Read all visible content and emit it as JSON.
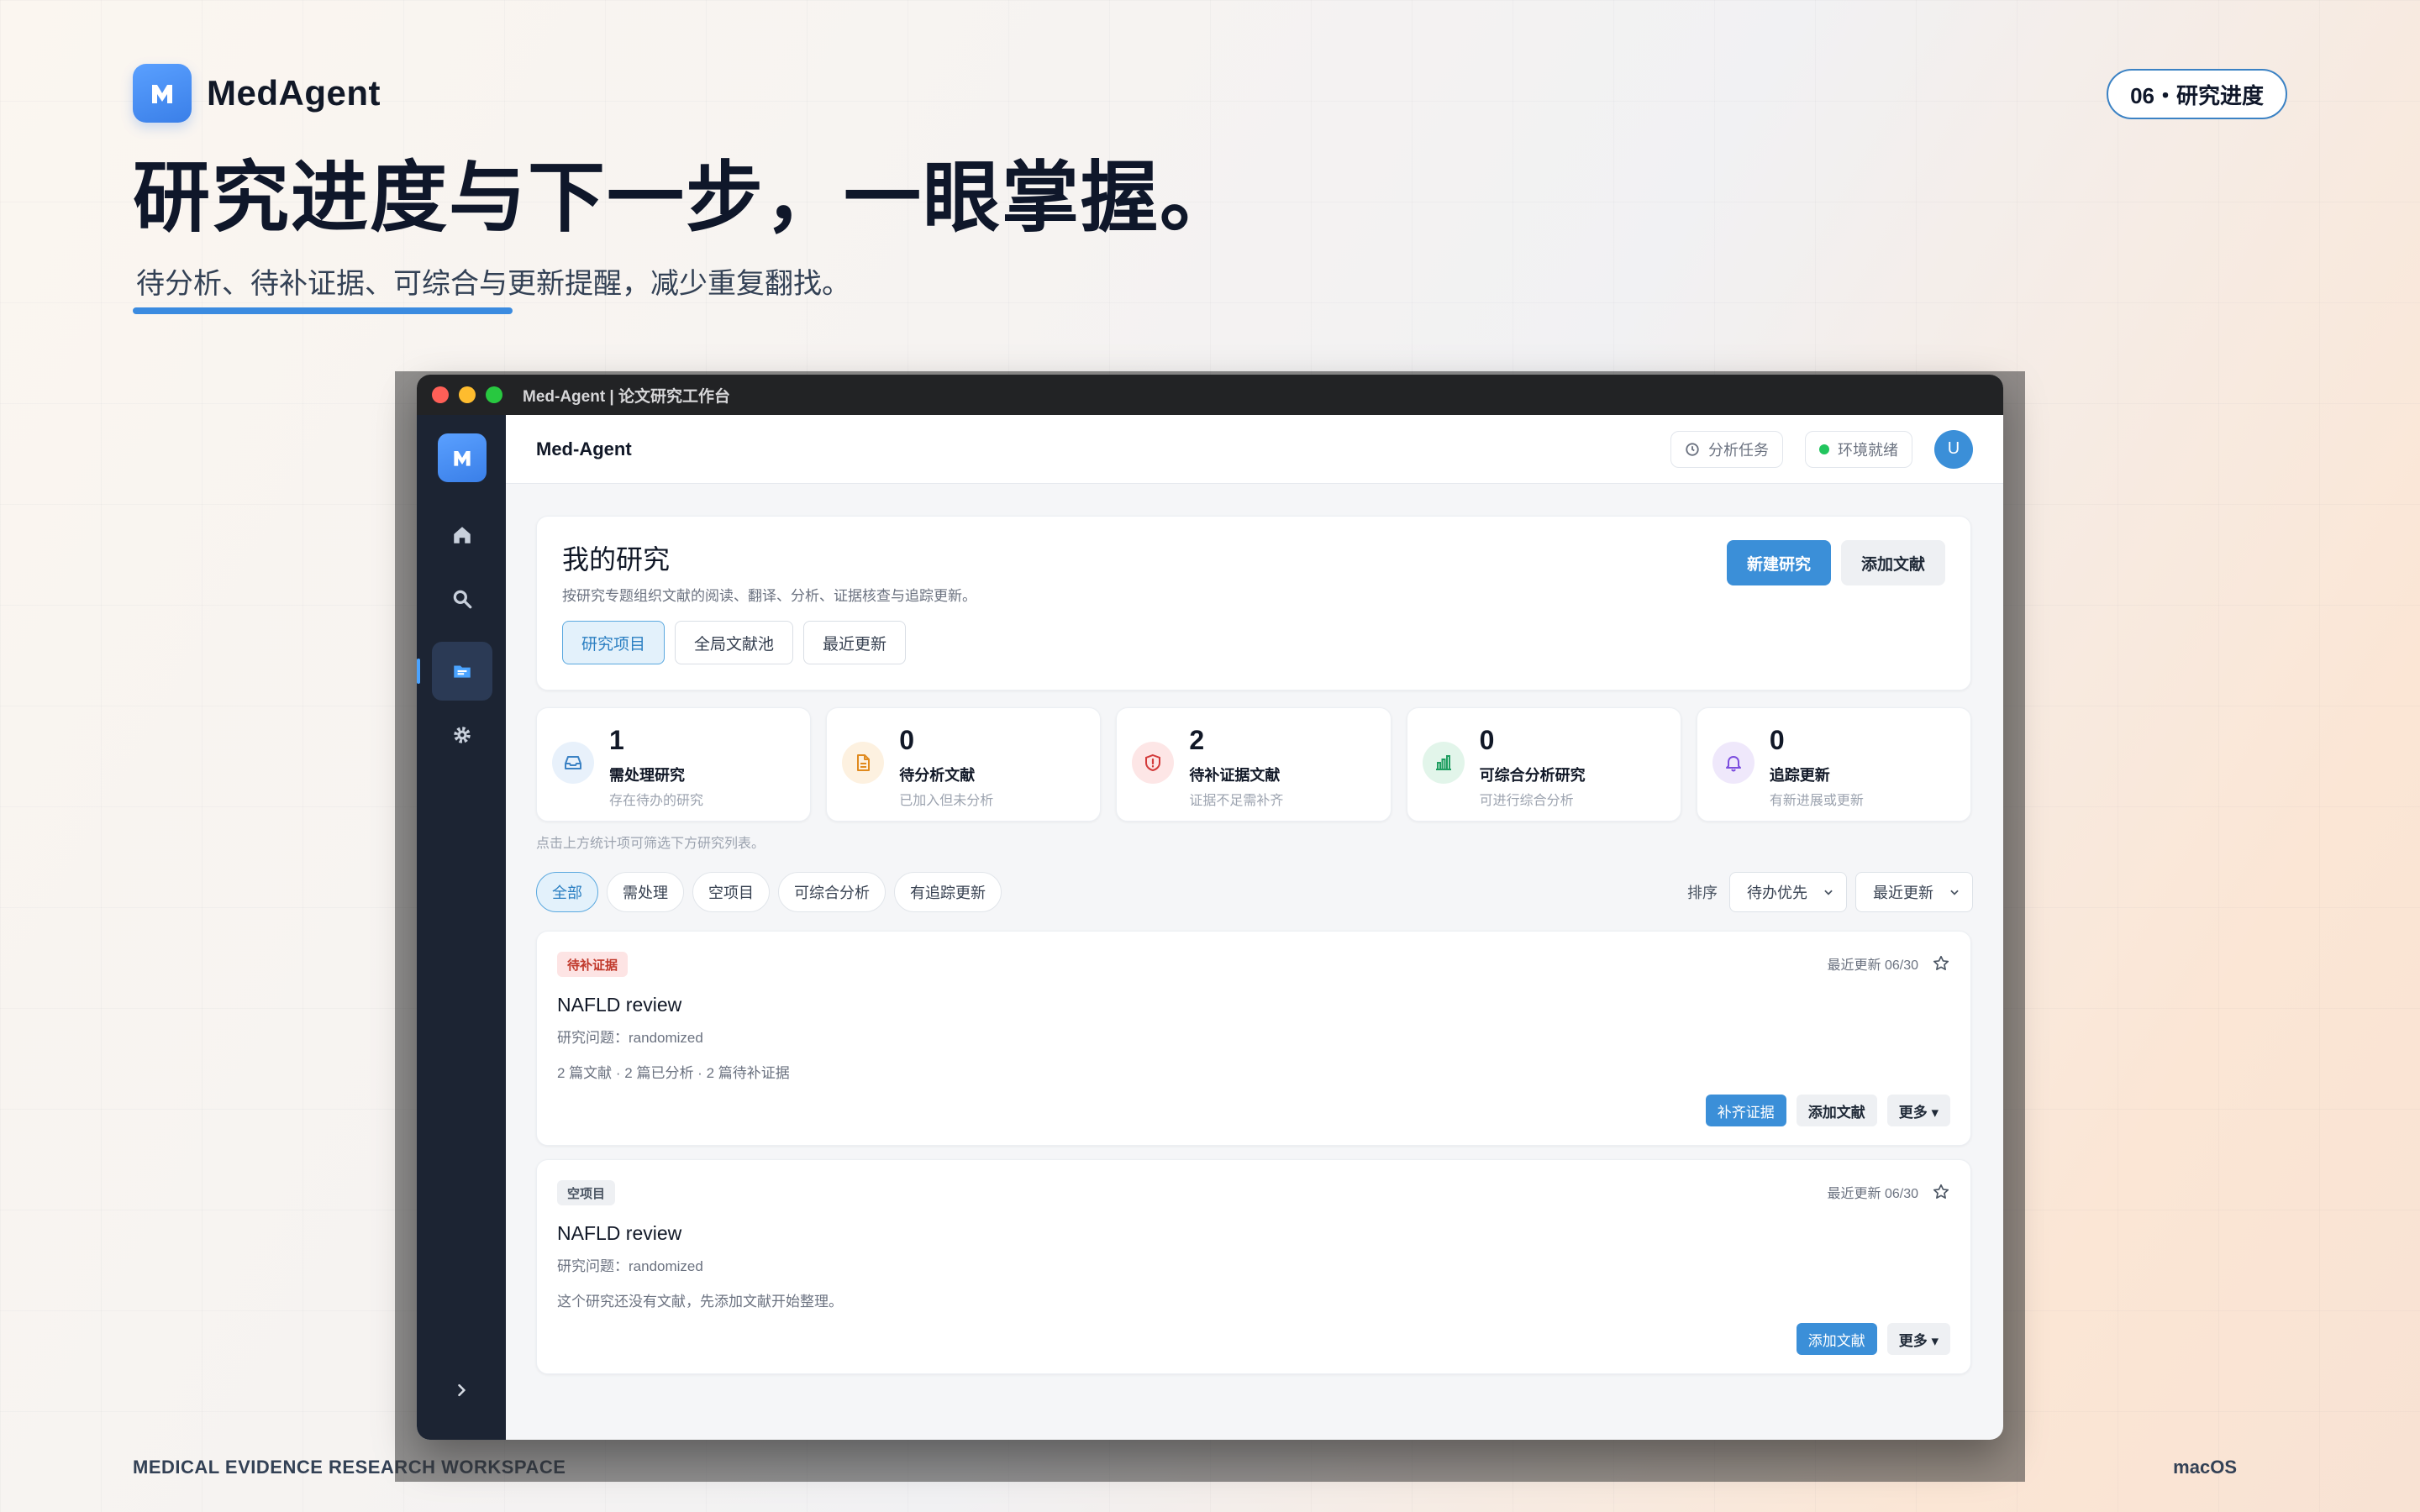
{
  "brand": {
    "name": "MedAgent"
  },
  "section_label": "06・研究进度",
  "headline": "研究进度与下一步，一眼掌握。",
  "subheadline": "待分析、待补证据、可综合与更新提醒，减少重复翻找。",
  "footer": {
    "left": "MEDICAL EVIDENCE RESEARCH WORKSPACE",
    "right": "macOS"
  },
  "window": {
    "title": "Med-Agent | 论文研究工作台"
  },
  "sidebar": {
    "items": [
      {
        "name": "home",
        "icon": "home-icon"
      },
      {
        "name": "search",
        "icon": "search-icon"
      },
      {
        "name": "research",
        "icon": "folder-icon",
        "active": true
      },
      {
        "name": "settings",
        "icon": "gear-icon"
      }
    ]
  },
  "topbar": {
    "title": "Med-Agent",
    "tasks_label": "分析任务",
    "env_label": "环境就绪",
    "avatar": "U"
  },
  "hero": {
    "title": "我的研究",
    "description": "按研究专题组织文献的阅读、翻译、分析、证据核查与追踪更新。",
    "tabs": [
      "研究项目",
      "全局文献池",
      "最近更新"
    ],
    "new_button": "新建研究",
    "add_button": "添加文献"
  },
  "stats": [
    {
      "value": "1",
      "label": "需处理研究",
      "sub": "存在待办的研究",
      "color": "#3b82c4",
      "bg": "#e8f1fb",
      "icon": "inbox-icon"
    },
    {
      "value": "0",
      "label": "待分析文献",
      "sub": "已加入但未分析",
      "color": "#e08a1e",
      "bg": "#fdf1e0",
      "icon": "document-icon"
    },
    {
      "value": "2",
      "label": "待补证据文献",
      "sub": "证据不足需补齐",
      "color": "#d33a3a",
      "bg": "#fde6e6",
      "icon": "shield-alert-icon"
    },
    {
      "value": "0",
      "label": "可综合分析研究",
      "sub": "可进行综合分析",
      "color": "#1f9e61",
      "bg": "#e2f5ea",
      "icon": "bar-chart-icon"
    },
    {
      "value": "0",
      "label": "追踪更新",
      "sub": "有新进展或更新",
      "color": "#7c4dde",
      "bg": "#efe8fb",
      "icon": "bell-icon"
    }
  ],
  "hint": "点击上方统计项可筛选下方研究列表。",
  "filters": [
    "全部",
    "需处理",
    "空项目",
    "可综合分析",
    "有追踪更新"
  ],
  "sort": {
    "label": "排序",
    "primary": "待办优先",
    "secondary": "最近更新"
  },
  "projects": [
    {
      "badge": "待补证据",
      "badge_type": "red",
      "updated": "最近更新 06/30",
      "title": "NAFLD review",
      "question": "研究问题：randomized",
      "stats": "2 篇文献 · 2 篇已分析 · 2 篇待补证据",
      "actions": {
        "primary": "补齐证据",
        "secondary": "添加文献",
        "more": "更多 ▾"
      }
    },
    {
      "badge": "空项目",
      "badge_type": "gray",
      "updated": "最近更新 06/30",
      "title": "NAFLD review",
      "question": "研究问题：randomized",
      "stats": "这个研究还没有文献，先添加文献开始整理。",
      "actions": {
        "primary": "添加文献",
        "more": "更多 ▾"
      }
    }
  ]
}
